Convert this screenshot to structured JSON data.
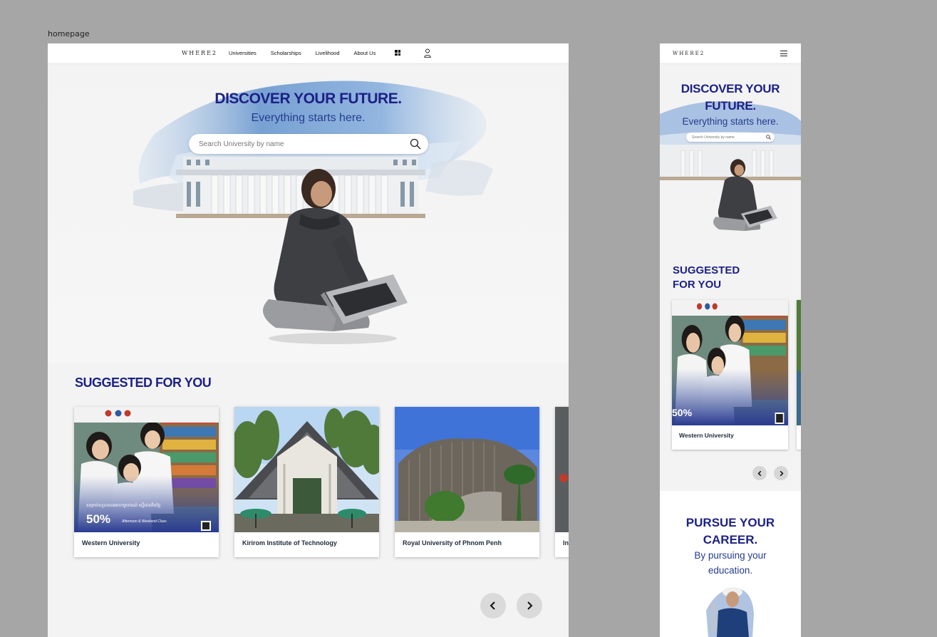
{
  "frame_label": "homepage",
  "brand": {
    "logo": "WHERE2"
  },
  "nav": {
    "items": [
      "Universities",
      "Scholarships",
      "Livelihood",
      "About Us"
    ]
  },
  "hero": {
    "title": "DISCOVER YOUR FUTURE.",
    "subtitle": "Everything starts here.",
    "search_placeholder": "Search University by name"
  },
  "suggested": {
    "title": "SUGGESTED FOR YOU",
    "cards": [
      {
        "name": "Western University"
      },
      {
        "name": "Kirirom Institute of Technology"
      },
      {
        "name": "Royal University of Phnom Penh"
      },
      {
        "name": "In"
      }
    ],
    "promo": {
      "percent": "50%",
      "khmer_text": "សម្រាប់ទទួលបានអាហារូបករណ៍ ស្ទើរឥតគិតថ្លៃ",
      "class_text": "Afternoon & Weekend Class"
    }
  },
  "mobile": {
    "hero_title_line1": "DISCOVER YOUR",
    "hero_title_line2": "FUTURE.",
    "hero_subtitle": "Everything starts here.",
    "search_placeholder": "Search University by name",
    "suggested_title_line1": "SUGGESTED",
    "suggested_title_line2": "FOR YOU",
    "card_name": "Western University",
    "pursue_title_line1": "PURSUE YOUR",
    "pursue_title_line2": "CAREER.",
    "pursue_subtitle": "By pursuing your education."
  },
  "colors": {
    "primary": "#1c2185",
    "accent": "#253c8f",
    "background": "#f3f3f3",
    "canvas": "#a6a6a6"
  }
}
